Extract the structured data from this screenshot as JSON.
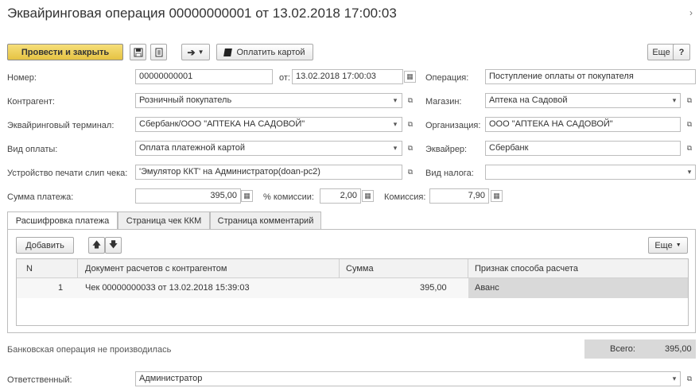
{
  "title": "Эквайринговая операция 00000000001 от 13.02.2018 17:00:03",
  "toolbar": {
    "post_close": "Провести и закрыть",
    "pay_card": "Оплатить картой",
    "more": "Еще",
    "help": "?"
  },
  "fields": {
    "number_label": "Номер:",
    "number_value": "00000000001",
    "from_label": "от:",
    "date_value": "13.02.2018 17:00:03",
    "operation_label": "Операция:",
    "operation_value": "Поступление оплаты от покупателя",
    "counterparty_label": "Контрагент:",
    "counterparty_value": "Розничный покупатель",
    "store_label": "Магазин:",
    "store_value": "Аптека на Садовой",
    "terminal_label": "Эквайринговый терминал:",
    "terminal_value": "Сбербанк/ООО \"АПТЕКА НА САДОВОЙ\"",
    "org_label": "Организация:",
    "org_value": "ООО \"АПТЕКА НА САДОВОЙ\"",
    "paytype_label": "Вид оплаты:",
    "paytype_value": "Оплата платежной картой",
    "acquirer_label": "Эквайрер:",
    "acquirer_value": "Сбербанк",
    "printer_label": "Устройство печати слип чека:",
    "printer_value": "'Эмулятор ККТ' на Администратор(doan-pc2)",
    "tax_label": "Вид налога:",
    "tax_value": "",
    "amount_label": "Сумма платежа:",
    "amount_value": "395,00",
    "commission_pct_label": "% комиссии:",
    "commission_pct_value": "2,00",
    "commission_label": "Комиссия:",
    "commission_value": "7,90"
  },
  "tabs": [
    {
      "label": "Расшифровка платежа"
    },
    {
      "label": "Страница чек ККМ"
    },
    {
      "label": "Страница комментарий"
    }
  ],
  "table_toolbar": {
    "add": "Добавить",
    "more": "Еще"
  },
  "table": {
    "headers": [
      "N",
      "Документ расчетов с контрагентом",
      "Сумма",
      "Признак способа расчета"
    ],
    "rows": [
      {
        "n": "1",
        "doc": "Чек 00000000033 от 13.02.2018 15:39:03",
        "sum": "395,00",
        "sign": "Аванс"
      }
    ]
  },
  "footer": {
    "bank_status": "Банковская операция не производилась",
    "total_label": "Всего:",
    "total_value": "395,00",
    "responsible_label": "Ответственный:",
    "responsible_value": "Администратор"
  },
  "icons": [
    "save-icon",
    "document-icon",
    "arrow-icon",
    "card-icon",
    "calendar-icon",
    "calculator-icon",
    "dropdown-icon",
    "open-icon",
    "up-arrow-icon",
    "down-arrow-icon"
  ],
  "colors": {
    "primary_button": "#e9c84a",
    "selected_cell": "#d9d9d9"
  }
}
